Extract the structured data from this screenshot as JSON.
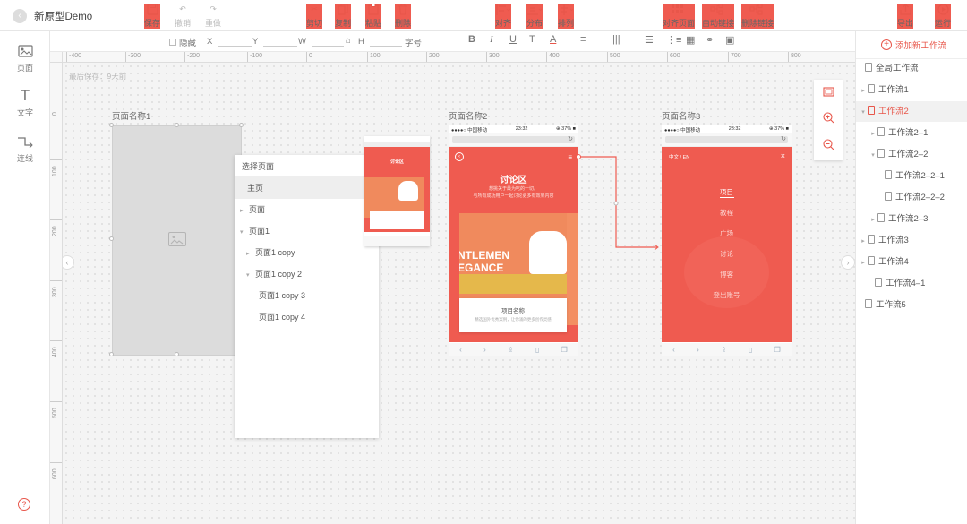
{
  "header": {
    "back_icon": "chevron-left-icon",
    "title": "新原型Demo",
    "tools": [
      {
        "id": "save",
        "label": "保存",
        "icon": "save-icon",
        "enabled": true
      },
      {
        "id": "undo",
        "label": "撤销",
        "icon": "undo-icon",
        "enabled": false
      },
      {
        "id": "redo",
        "label": "重做",
        "icon": "redo-icon",
        "enabled": false
      },
      {
        "id": "cut",
        "label": "剪切",
        "icon": "scissors-icon",
        "enabled": true
      },
      {
        "id": "copy",
        "label": "复制",
        "icon": "copy-icon",
        "enabled": true
      },
      {
        "id": "paste",
        "label": "粘贴",
        "icon": "paste-icon",
        "enabled": true
      },
      {
        "id": "delete",
        "label": "删除",
        "icon": "trash-icon",
        "enabled": true
      },
      {
        "id": "align",
        "label": "对齐",
        "icon": "align-icon",
        "enabled": true
      },
      {
        "id": "distribute",
        "label": "分布",
        "icon": "distribute-icon",
        "enabled": true
      },
      {
        "id": "arrange",
        "label": "排列",
        "icon": "arrange-icon",
        "enabled": true
      },
      {
        "id": "align-page",
        "label": "对齐页面",
        "icon": "align-page-icon",
        "enabled": true
      },
      {
        "id": "auto-link",
        "label": "自动链接",
        "icon": "auto-link-icon",
        "enabled": true
      },
      {
        "id": "remove-link",
        "label": "删除链接",
        "icon": "remove-link-icon",
        "enabled": true
      },
      {
        "id": "export",
        "label": "导出",
        "icon": "export-icon",
        "enabled": true
      },
      {
        "id": "run",
        "label": "运行",
        "icon": "play-icon",
        "enabled": true
      }
    ]
  },
  "left_rail": {
    "items": [
      {
        "label": "页面",
        "icon": "image-icon"
      },
      {
        "label": "文字",
        "icon": "text-icon"
      },
      {
        "label": "连线",
        "icon": "connector-icon"
      }
    ],
    "help_icon": "help-icon"
  },
  "properties": {
    "hide_label": "隐藏",
    "x_label": "X",
    "y_label": "Y",
    "w_label": "W",
    "h_label": "H",
    "font_size_label": "字号",
    "lock_icon": "lock-icon",
    "format_icons": [
      "bold-icon",
      "italic-icon",
      "underline-icon",
      "strikethrough-icon",
      "font-color-icon",
      "align-left-icon",
      "line-spacing-icon",
      "list-icon",
      "numbered-list-icon",
      "table-icon",
      "link-icon",
      "picture-icon"
    ]
  },
  "ruler": {
    "h_marks": [
      "-400",
      "-300",
      "-200",
      "-100",
      "0",
      "100",
      "200",
      "300",
      "400",
      "500",
      "600",
      "700",
      "800"
    ],
    "v_marks": [
      "0",
      "100",
      "200",
      "300",
      "400",
      "500",
      "600"
    ]
  },
  "canvas": {
    "last_saved": "最后保存：9天前",
    "page1_label": "页面名称1",
    "page2_label": "页面名称2",
    "page3_label": "页面名称3",
    "select_panel": {
      "title": "选择页面",
      "items": [
        {
          "label": "主页",
          "caret": "",
          "active": true
        },
        {
          "label": "页面",
          "caret": "▸",
          "active": false
        },
        {
          "label": "页面1",
          "caret": "▾",
          "active": false
        },
        {
          "label": "页面1 copy",
          "caret": "▸",
          "active": false
        },
        {
          "label": "页面1 copy 2",
          "caret": "▾",
          "active": false
        },
        {
          "label": "页面1 copy 3",
          "caret": "",
          "active": false
        },
        {
          "label": "页面1 copy 4",
          "caret": "",
          "active": false
        }
      ]
    },
    "preview": {
      "title": "讨论区"
    },
    "phone2": {
      "carrier": "●●●●○ 中国移动 ",
      "time": "23:32",
      "battery": "⊕ 37% ■",
      "title": "讨论区",
      "subtitle1": "想挑关于最为吃的一切。",
      "subtitle2": "与所有成功用户一起讨论更多有效果内容",
      "hero_text1": "NTLEMEN",
      "hero_text2": "EGANCE",
      "card_title": "项目名称",
      "card_desc": "精选国外优秀案例，让你涌的更多创作灵感"
    },
    "phone3": {
      "carrier": "●●●●○ 中国移动 ",
      "time": "23:32",
      "battery": "⊕ 37% ■",
      "lang": "中文  /  EN",
      "menu": [
        "项目",
        "教程",
        "广场",
        "讨论",
        "博客",
        "登出账号"
      ]
    },
    "zoom_icons": [
      "fit-screen-icon",
      "zoom-in-icon",
      "zoom-out-icon"
    ]
  },
  "workflow": {
    "add_label": "添加新工作流",
    "items": [
      {
        "label": "全局工作流",
        "caret": "",
        "level": 0,
        "active": false
      },
      {
        "label": "工作流1",
        "caret": "▸",
        "level": 0,
        "active": false
      },
      {
        "label": "工作流2",
        "caret": "▾",
        "level": 0,
        "active": true
      },
      {
        "label": "工作流2–1",
        "caret": "▸",
        "level": 1,
        "active": false
      },
      {
        "label": "工作流2–2",
        "caret": "▾",
        "level": 1,
        "active": false
      },
      {
        "label": "工作流2–2–1",
        "caret": "",
        "level": 2,
        "active": false
      },
      {
        "label": "工作流2–2–2",
        "caret": "",
        "level": 2,
        "active": false
      },
      {
        "label": "工作流2–3",
        "caret": "▸",
        "level": 1,
        "active": false
      },
      {
        "label": "工作流3",
        "caret": "▸",
        "level": 0,
        "active": false
      },
      {
        "label": "工作流4",
        "caret": "▸",
        "level": 0,
        "active": false
      },
      {
        "label": "工作流4–1",
        "caret": "",
        "level": 1,
        "active": false
      },
      {
        "label": "工作流5",
        "caret": "",
        "level": 0,
        "active": false
      }
    ]
  },
  "colors": {
    "accent": "#e8564a",
    "phone_red": "#ef5b50"
  }
}
